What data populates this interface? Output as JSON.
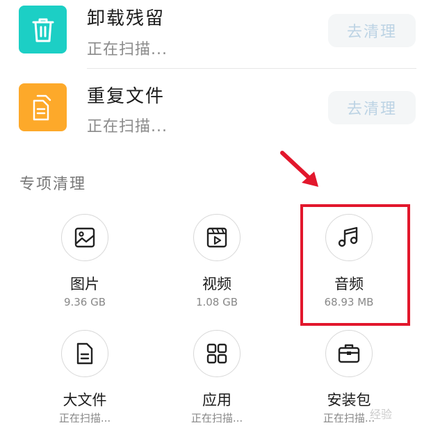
{
  "rows": [
    {
      "title": "卸载残留",
      "status": "正在扫描...",
      "button": "去清理",
      "icon": "trash-icon",
      "color": "#1ccfc5"
    },
    {
      "title": "重复文件",
      "status": "正在扫描...",
      "button": "去清理",
      "icon": "duplicate-file-icon",
      "color": "#fda92a"
    }
  ],
  "section_title": "专项清理",
  "grid": [
    {
      "label": "图片",
      "sub": "9.36 GB",
      "icon": "image-icon"
    },
    {
      "label": "视频",
      "sub": "1.08 GB",
      "icon": "video-icon"
    },
    {
      "label": "音频",
      "sub": "68.93 MB",
      "icon": "music-note-icon"
    },
    {
      "label": "大文件",
      "sub": "正在扫描...",
      "icon": "document-icon"
    },
    {
      "label": "应用",
      "sub": "正在扫描...",
      "icon": "apps-grid-icon"
    },
    {
      "label": "安装包",
      "sub": "正在扫描...",
      "icon": "briefcase-icon"
    }
  ],
  "annotation_color": "#e2172c",
  "watermark": "经验"
}
